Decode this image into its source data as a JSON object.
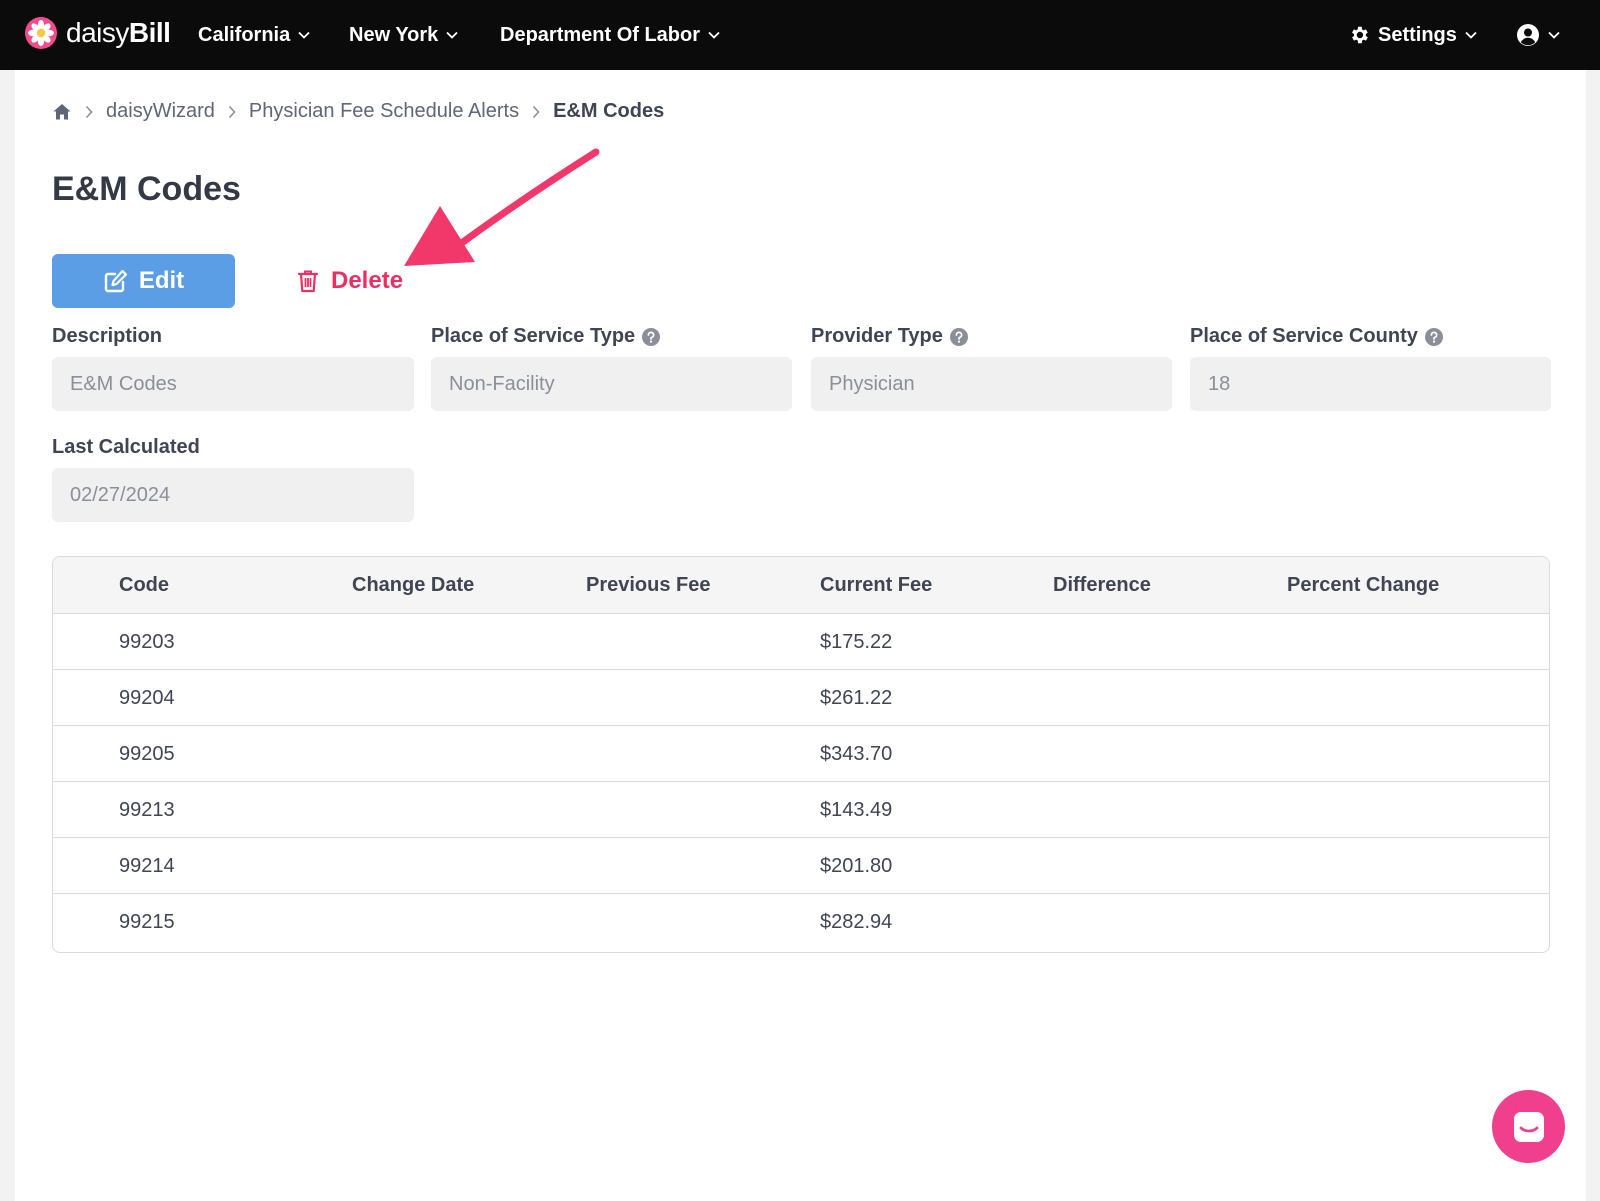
{
  "brand": {
    "name_light": "daisy",
    "name_bold": "Bill"
  },
  "nav": {
    "menus": [
      "California",
      "New York",
      "Department Of Labor"
    ],
    "settings_label": "Settings"
  },
  "breadcrumb": {
    "items": [
      "daisyWizard",
      "Physician Fee Schedule Alerts"
    ],
    "current": "E&M Codes"
  },
  "page": {
    "title": "E&M Codes",
    "edit_label": "Edit",
    "delete_label": "Delete"
  },
  "fields": {
    "description": {
      "label": "Description",
      "value": "E&M Codes"
    },
    "place_of_service_type": {
      "label": "Place of Service Type",
      "value": "Non-Facility"
    },
    "provider_type": {
      "label": "Provider Type",
      "value": "Physician"
    },
    "place_of_service_county": {
      "label": "Place of Service County",
      "value": "18"
    },
    "last_calculated": {
      "label": "Last Calculated",
      "value": "02/27/2024"
    }
  },
  "table": {
    "headers": [
      "Code",
      "Change Date",
      "Previous Fee",
      "Current Fee",
      "Difference",
      "Percent Change"
    ],
    "rows": [
      {
        "code": "99203",
        "change_date": "",
        "previous_fee": "",
        "current_fee": "$175.22",
        "difference": "",
        "percent_change": ""
      },
      {
        "code": "99204",
        "change_date": "",
        "previous_fee": "",
        "current_fee": "$261.22",
        "difference": "",
        "percent_change": ""
      },
      {
        "code": "99205",
        "change_date": "",
        "previous_fee": "",
        "current_fee": "$343.70",
        "difference": "",
        "percent_change": ""
      },
      {
        "code": "99213",
        "change_date": "",
        "previous_fee": "",
        "current_fee": "$143.49",
        "difference": "",
        "percent_change": ""
      },
      {
        "code": "99214",
        "change_date": "",
        "previous_fee": "",
        "current_fee": "$201.80",
        "difference": "",
        "percent_change": ""
      },
      {
        "code": "99215",
        "change_date": "",
        "previous_fee": "",
        "current_fee": "$282.94",
        "difference": "",
        "percent_change": ""
      }
    ]
  },
  "icons": {
    "home": "home-icon",
    "edit": "edit-icon",
    "delete": "trash-icon",
    "help": "question-circle-icon",
    "settings": "gear-icon",
    "account": "user-circle-icon",
    "chat": "chat-icon",
    "annotation": "arrow-annotation"
  },
  "colors": {
    "nav_bg": "#0b0b0c",
    "edit_button": "#5b9ee6",
    "delete_text": "#ec2f62",
    "arrow": "#f2386b",
    "chat_bubble": "#f03f8c",
    "brand_flower": "#f14d8e"
  }
}
